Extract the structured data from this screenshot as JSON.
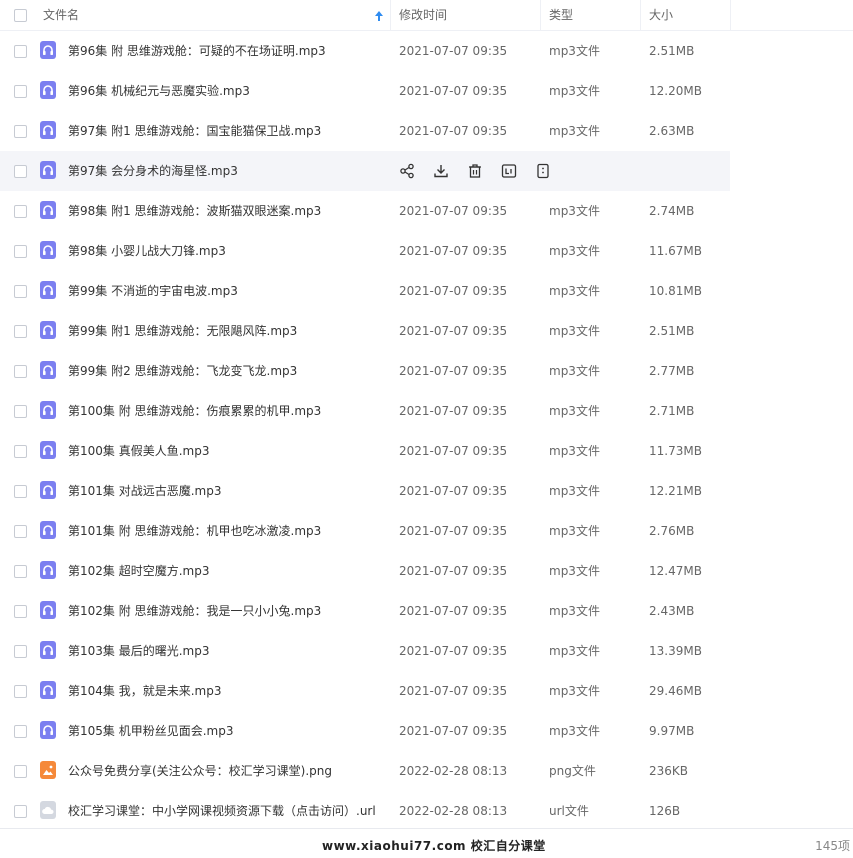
{
  "header": {
    "name": "文件名",
    "time": "修改时间",
    "type": "类型",
    "size": "大小"
  },
  "rows": [
    {
      "name": "第96集 附 思维游戏舱：可疑的不在场证明.mp3",
      "time": "2021-07-07 09:35",
      "type": "mp3文件",
      "size": "2.51MB",
      "icon": "audio-file-icon"
    },
    {
      "name": "第96集 机械纪元与恶魔实验.mp3",
      "time": "2021-07-07 09:35",
      "type": "mp3文件",
      "size": "12.20MB",
      "icon": "audio-file-icon"
    },
    {
      "name": "第97集 附1 思维游戏舱：国宝能猫保卫战.mp3",
      "time": "2021-07-07 09:35",
      "type": "mp3文件",
      "size": "2.63MB",
      "icon": "audio-file-icon"
    },
    {
      "name": "第97集 会分身术的海星怪.mp3",
      "time": "",
      "type": "",
      "size": "",
      "icon": "audio-file-icon",
      "hover": true
    },
    {
      "name": "第98集 附1 思维游戏舱：波斯猫双眼迷案.mp3",
      "time": "2021-07-07 09:35",
      "type": "mp3文件",
      "size": "2.74MB",
      "icon": "audio-file-icon"
    },
    {
      "name": "第98集 小婴儿战大刀锋.mp3",
      "time": "2021-07-07 09:35",
      "type": "mp3文件",
      "size": "11.67MB",
      "icon": "audio-file-icon"
    },
    {
      "name": "第99集 不消逝的宇宙电波.mp3",
      "time": "2021-07-07 09:35",
      "type": "mp3文件",
      "size": "10.81MB",
      "icon": "audio-file-icon"
    },
    {
      "name": "第99集 附1 思维游戏舱：无限飓风阵.mp3",
      "time": "2021-07-07 09:35",
      "type": "mp3文件",
      "size": "2.51MB",
      "icon": "audio-file-icon"
    },
    {
      "name": "第99集 附2 思维游戏舱：飞龙变飞龙.mp3",
      "time": "2021-07-07 09:35",
      "type": "mp3文件",
      "size": "2.77MB",
      "icon": "audio-file-icon"
    },
    {
      "name": "第100集 附 思维游戏舱：伤痕累累的机甲.mp3",
      "time": "2021-07-07 09:35",
      "type": "mp3文件",
      "size": "2.71MB",
      "icon": "audio-file-icon"
    },
    {
      "name": "第100集 真假美人鱼.mp3",
      "time": "2021-07-07 09:35",
      "type": "mp3文件",
      "size": "11.73MB",
      "icon": "audio-file-icon"
    },
    {
      "name": "第101集 对战远古恶魔.mp3",
      "time": "2021-07-07 09:35",
      "type": "mp3文件",
      "size": "12.21MB",
      "icon": "audio-file-icon"
    },
    {
      "name": "第101集 附 思维游戏舱：机甲也吃冰激凌.mp3",
      "time": "2021-07-07 09:35",
      "type": "mp3文件",
      "size": "2.76MB",
      "icon": "audio-file-icon"
    },
    {
      "name": "第102集 超时空魔方.mp3",
      "time": "2021-07-07 09:35",
      "type": "mp3文件",
      "size": "12.47MB",
      "icon": "audio-file-icon"
    },
    {
      "name": "第102集 附 思维游戏舱：我是一只小小兔.mp3",
      "time": "2021-07-07 09:35",
      "type": "mp3文件",
      "size": "2.43MB",
      "icon": "audio-file-icon"
    },
    {
      "name": "第103集 最后的曙光.mp3",
      "time": "2021-07-07 09:35",
      "type": "mp3文件",
      "size": "13.39MB",
      "icon": "audio-file-icon"
    },
    {
      "name": "第104集 我，就是未来.mp3",
      "time": "2021-07-07 09:35",
      "type": "mp3文件",
      "size": "29.46MB",
      "icon": "audio-file-icon"
    },
    {
      "name": "第105集 机甲粉丝见面会.mp3",
      "time": "2021-07-07 09:35",
      "type": "mp3文件",
      "size": "9.97MB",
      "icon": "audio-file-icon"
    },
    {
      "name": "公众号免费分享(关注公众号：校汇学习课堂).png",
      "time": "2022-02-28 08:13",
      "type": "png文件",
      "size": "236KB",
      "icon": "image-file-icon"
    },
    {
      "name": "校汇学习课堂：中小学网课视频资源下载（点击访问）.url",
      "time": "2022-02-28 08:13",
      "type": "url文件",
      "size": "126B",
      "icon": "link-file-icon"
    }
  ],
  "hover_actions": [
    "share-icon",
    "download-icon",
    "delete-icon",
    "rename-icon",
    "more-icon"
  ],
  "footer": {
    "watermark": "www.xiaohui77.com 校汇自分课堂",
    "count": "145项"
  },
  "colors": {
    "accent": "#2f8cf0",
    "audio_icon": "#7b7ff0",
    "image_icon": "#f5893a",
    "link_icon": "#d4d8e0",
    "hover_row": "#f4f5f9"
  }
}
